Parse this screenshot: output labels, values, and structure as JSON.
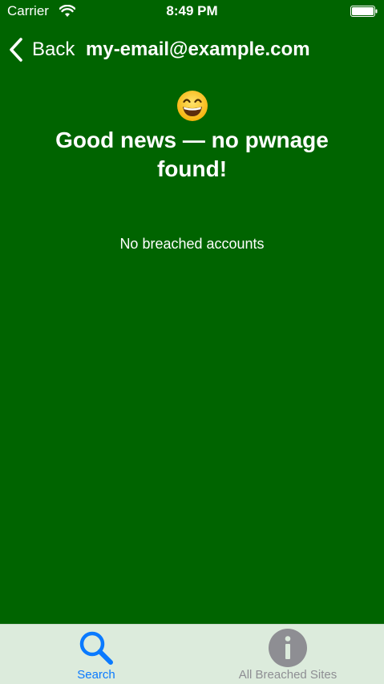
{
  "status_bar": {
    "carrier": "Carrier",
    "time": "8:49 PM",
    "icons": [
      "wifi-icon",
      "battery-icon"
    ]
  },
  "nav": {
    "back_label": "Back",
    "title": "my-email@example.com",
    "back_icon": "chevron-left-icon"
  },
  "content": {
    "emoji_icon": "grinning-face-emoji",
    "headline": "Good news — no pwnage found!",
    "subtext": "No breached accounts"
  },
  "tab_bar": {
    "tabs": [
      {
        "label": "Search",
        "icon": "search-icon",
        "selected": true
      },
      {
        "label": "All Breached Sites",
        "icon": "info-icon",
        "selected": false
      }
    ]
  },
  "colors": {
    "background": "#006400",
    "tab_bar_background": "#dcebdc",
    "active_tab": "#0a7aff",
    "inactive_tab": "#8e8e93"
  }
}
